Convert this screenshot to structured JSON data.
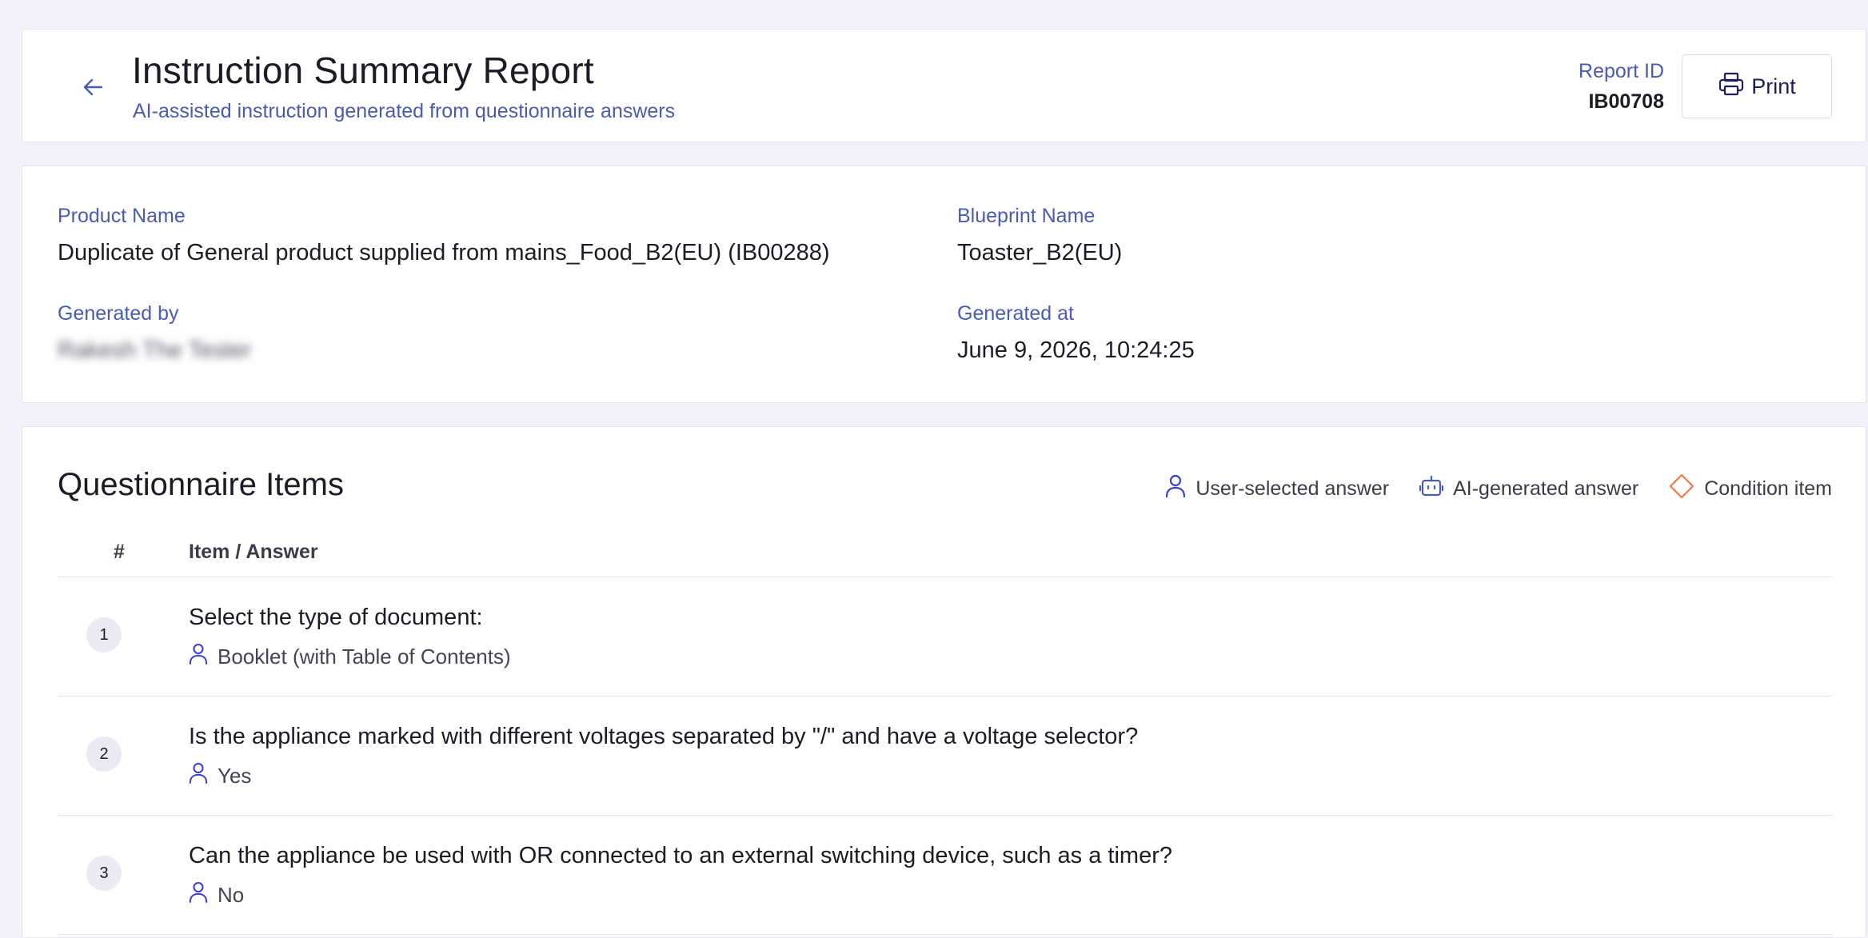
{
  "header": {
    "title": "Instruction Summary Report",
    "subtitle": "AI-assisted instruction generated from questionnaire answers",
    "report_id_label": "Report ID",
    "report_id_value": "IB00708",
    "print_label": "Print",
    "back_icon": "arrow-left-icon",
    "print_icon": "printer-icon"
  },
  "info": {
    "product_name_label": "Product Name",
    "product_name_value": "Duplicate of General product supplied from mains_Food_B2(EU) (IB00288)",
    "blueprint_name_label": "Blueprint Name",
    "blueprint_name_value": "Toaster_B2(EU)",
    "generated_by_label": "Generated by",
    "generated_by_value": "Rakesh The Tester",
    "generated_at_label": "Generated at",
    "generated_at_value": "June 9, 2026, 10:24:25"
  },
  "questionnaire": {
    "title": "Questionnaire Items",
    "legend": {
      "user_selected": "User-selected answer",
      "ai_generated": "AI-generated answer",
      "condition_item": "Condition item"
    },
    "columns": {
      "num": "#",
      "item": "Item / Answer"
    },
    "items": [
      {
        "num": "1",
        "question": "Select the type of document:",
        "answer": "Booklet (with Table of Contents)",
        "answer_type": "user"
      },
      {
        "num": "2",
        "question": "Is the appliance marked with different voltages separated by \"/\" and have a voltage selector?",
        "answer": "Yes",
        "answer_type": "user"
      },
      {
        "num": "3",
        "question": "Can the appliance be used with OR connected to an external switching device, such as a timer?",
        "answer": "No",
        "answer_type": "user"
      }
    ]
  },
  "colors": {
    "accent": "#4a5bb0",
    "user_icon": "#3a3fd1",
    "ai_icon": "#4a5bb0",
    "condition_icon": "#f27a4a",
    "background": "#f3f2fb"
  }
}
